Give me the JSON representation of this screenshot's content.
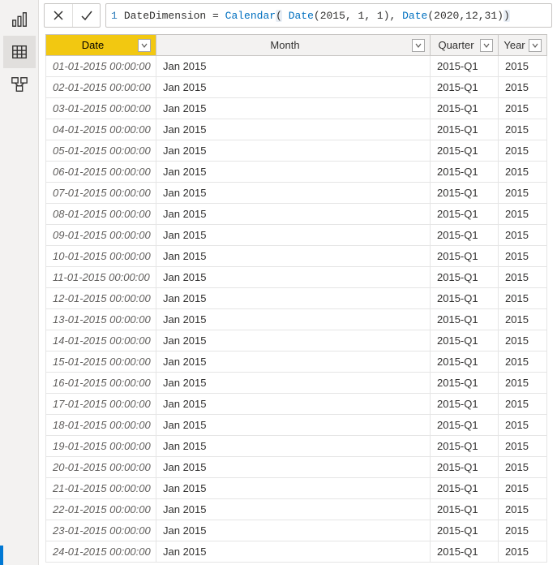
{
  "view_rail": {
    "report": "report-view",
    "data": "data-view",
    "model": "model-view"
  },
  "formula": {
    "line_number": "1",
    "tokens": [
      {
        "text": "DateDimension ",
        "cls": ""
      },
      {
        "text": "= ",
        "cls": ""
      },
      {
        "text": "Calendar",
        "cls": "fn"
      },
      {
        "text": "(",
        "cls": "paren-hl"
      },
      {
        "text": " ",
        "cls": ""
      },
      {
        "text": "Date",
        "cls": "fn"
      },
      {
        "text": "(2015, 1, 1), ",
        "cls": ""
      },
      {
        "text": "Date",
        "cls": "fn"
      },
      {
        "text": "(2020,12,31)",
        "cls": ""
      },
      {
        "text": ")",
        "cls": "paren-hl"
      }
    ]
  },
  "table": {
    "columns": [
      {
        "label": "Date",
        "key": true
      },
      {
        "label": "Month",
        "key": false
      },
      {
        "label": "Quarter",
        "key": false
      },
      {
        "label": "Year",
        "key": false
      }
    ],
    "rows": [
      {
        "date": "01-01-2015 00:00:00",
        "month": "Jan 2015",
        "quarter": "2015-Q1",
        "year": "2015"
      },
      {
        "date": "02-01-2015 00:00:00",
        "month": "Jan 2015",
        "quarter": "2015-Q1",
        "year": "2015"
      },
      {
        "date": "03-01-2015 00:00:00",
        "month": "Jan 2015",
        "quarter": "2015-Q1",
        "year": "2015"
      },
      {
        "date": "04-01-2015 00:00:00",
        "month": "Jan 2015",
        "quarter": "2015-Q1",
        "year": "2015"
      },
      {
        "date": "05-01-2015 00:00:00",
        "month": "Jan 2015",
        "quarter": "2015-Q1",
        "year": "2015"
      },
      {
        "date": "06-01-2015 00:00:00",
        "month": "Jan 2015",
        "quarter": "2015-Q1",
        "year": "2015"
      },
      {
        "date": "07-01-2015 00:00:00",
        "month": "Jan 2015",
        "quarter": "2015-Q1",
        "year": "2015"
      },
      {
        "date": "08-01-2015 00:00:00",
        "month": "Jan 2015",
        "quarter": "2015-Q1",
        "year": "2015"
      },
      {
        "date": "09-01-2015 00:00:00",
        "month": "Jan 2015",
        "quarter": "2015-Q1",
        "year": "2015"
      },
      {
        "date": "10-01-2015 00:00:00",
        "month": "Jan 2015",
        "quarter": "2015-Q1",
        "year": "2015"
      },
      {
        "date": "11-01-2015 00:00:00",
        "month": "Jan 2015",
        "quarter": "2015-Q1",
        "year": "2015"
      },
      {
        "date": "12-01-2015 00:00:00",
        "month": "Jan 2015",
        "quarter": "2015-Q1",
        "year": "2015"
      },
      {
        "date": "13-01-2015 00:00:00",
        "month": "Jan 2015",
        "quarter": "2015-Q1",
        "year": "2015"
      },
      {
        "date": "14-01-2015 00:00:00",
        "month": "Jan 2015",
        "quarter": "2015-Q1",
        "year": "2015"
      },
      {
        "date": "15-01-2015 00:00:00",
        "month": "Jan 2015",
        "quarter": "2015-Q1",
        "year": "2015"
      },
      {
        "date": "16-01-2015 00:00:00",
        "month": "Jan 2015",
        "quarter": "2015-Q1",
        "year": "2015"
      },
      {
        "date": "17-01-2015 00:00:00",
        "month": "Jan 2015",
        "quarter": "2015-Q1",
        "year": "2015"
      },
      {
        "date": "18-01-2015 00:00:00",
        "month": "Jan 2015",
        "quarter": "2015-Q1",
        "year": "2015"
      },
      {
        "date": "19-01-2015 00:00:00",
        "month": "Jan 2015",
        "quarter": "2015-Q1",
        "year": "2015"
      },
      {
        "date": "20-01-2015 00:00:00",
        "month": "Jan 2015",
        "quarter": "2015-Q1",
        "year": "2015"
      },
      {
        "date": "21-01-2015 00:00:00",
        "month": "Jan 2015",
        "quarter": "2015-Q1",
        "year": "2015"
      },
      {
        "date": "22-01-2015 00:00:00",
        "month": "Jan 2015",
        "quarter": "2015-Q1",
        "year": "2015"
      },
      {
        "date": "23-01-2015 00:00:00",
        "month": "Jan 2015",
        "quarter": "2015-Q1",
        "year": "2015"
      },
      {
        "date": "24-01-2015 00:00:00",
        "month": "Jan 2015",
        "quarter": "2015-Q1",
        "year": "2015"
      }
    ]
  }
}
